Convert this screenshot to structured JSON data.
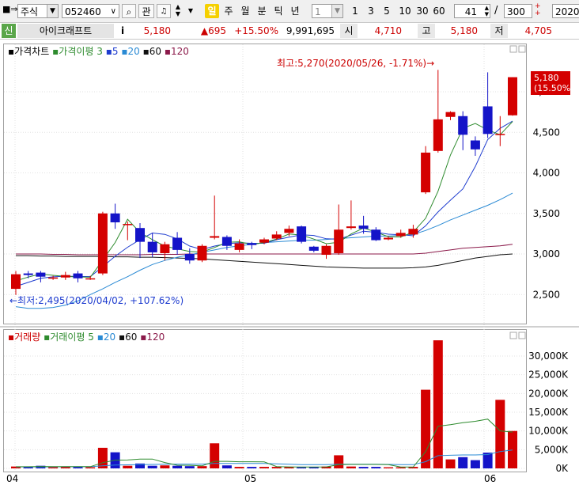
{
  "toolbar": {
    "market": "주식",
    "code": "052460",
    "gwan_label": "관",
    "periods": [
      "일",
      "주",
      "월",
      "분",
      "틱",
      "년"
    ],
    "selected_period": "일",
    "unit_value": "1",
    "intervals": [
      "1",
      "3",
      "5",
      "10",
      "30",
      "60"
    ],
    "count_value": "41",
    "count_total": "300",
    "date_value": "2020/"
  },
  "quote": {
    "tag": "신",
    "name": "아이크래프트",
    "info_icon": "i",
    "price": "5,180",
    "change": "▲695",
    "change_pct": "+15.50%",
    "volume": "9,991,695",
    "open_label": "시",
    "open": "4,710",
    "high_label": "고",
    "high": "5,180",
    "low_label": "저",
    "low": "4,705"
  },
  "price_panel": {
    "legend": [
      {
        "text": "가격차트",
        "color": "#000000"
      },
      {
        "text": "가격이평 3",
        "color": "#2e8b2e"
      },
      {
        "text": "5",
        "color": "#1e3ccf"
      },
      {
        "text": "20",
        "color": "#2a8ad4"
      },
      {
        "text": "60",
        "color": "#111111"
      },
      {
        "text": "120",
        "color": "#8b1a4a"
      }
    ],
    "y_ticks": [
      "5,000",
      "4,500",
      "4,000",
      "3,500",
      "3,000",
      "2,500"
    ],
    "annotation_high": "최고:5,270(2020/05/26, -1.71%)→",
    "annotation_low": "←최저:2,495(2020/04/02, +107.62%)",
    "last_price_label": "5,180",
    "last_pct_label": "(15.50%)"
  },
  "volume_panel": {
    "legend": [
      {
        "text": "거래량",
        "color": "#cc0000"
      },
      {
        "text": "거래이평 5",
        "color": "#2e8b2e"
      },
      {
        "text": "20",
        "color": "#2a8ad4"
      },
      {
        "text": "60",
        "color": "#111111"
      },
      {
        "text": "120",
        "color": "#8b1a4a"
      }
    ],
    "y_ticks": [
      "30,000K",
      "25,000K",
      "20,000K",
      "15,000K",
      "10,000K",
      "5,000K",
      "0K"
    ]
  },
  "x_axis": {
    "labels": [
      "04",
      "05",
      "06"
    ]
  },
  "chart_data": {
    "type": "candlestick",
    "y_ticks": [
      2500,
      3000,
      3500,
      4000,
      4500,
      5000
    ],
    "volume_ticks_k": [
      0,
      5000,
      10000,
      15000,
      20000,
      25000,
      30000
    ],
    "candles": [
      {
        "o": 2570,
        "c": 2750,
        "h": 2790,
        "l": 2495,
        "v": 500
      },
      {
        "o": 2760,
        "c": 2740,
        "h": 2790,
        "l": 2700,
        "v": 500
      },
      {
        "o": 2770,
        "c": 2720,
        "h": 2790,
        "l": 2650,
        "v": 700
      },
      {
        "o": 2700,
        "c": 2710,
        "h": 2730,
        "l": 2680,
        "v": 300
      },
      {
        "o": 2710,
        "c": 2740,
        "h": 2780,
        "l": 2680,
        "v": 400
      },
      {
        "o": 2760,
        "c": 2700,
        "h": 2790,
        "l": 2650,
        "v": 400
      },
      {
        "o": 2700,
        "c": 2700,
        "h": 2730,
        "l": 2680,
        "v": 300
      },
      {
        "o": 2760,
        "c": 3500,
        "h": 3520,
        "l": 2740,
        "v": 5500
      },
      {
        "o": 3500,
        "c": 3390,
        "h": 3620,
        "l": 3310,
        "v": 4300
      },
      {
        "o": 3360,
        "c": 3370,
        "h": 3400,
        "l": 3170,
        "v": 700
      },
      {
        "o": 3320,
        "c": 3150,
        "h": 3380,
        "l": 2950,
        "v": 1300
      },
      {
        "o": 3150,
        "c": 3020,
        "h": 3260,
        "l": 2960,
        "v": 700
      },
      {
        "o": 3010,
        "c": 3120,
        "h": 3150,
        "l": 2920,
        "v": 800
      },
      {
        "o": 3200,
        "c": 3050,
        "h": 3270,
        "l": 2990,
        "v": 700
      },
      {
        "o": 3000,
        "c": 2920,
        "h": 3070,
        "l": 2880,
        "v": 600
      },
      {
        "o": 2920,
        "c": 3100,
        "h": 3120,
        "l": 2900,
        "v": 600
      },
      {
        "o": 3200,
        "c": 3220,
        "h": 3720,
        "l": 3180,
        "v": 6700
      },
      {
        "o": 3210,
        "c": 3100,
        "h": 3230,
        "l": 3050,
        "v": 800
      },
      {
        "o": 3050,
        "c": 3130,
        "h": 3180,
        "l": 3020,
        "v": 400
      },
      {
        "o": 3130,
        "c": 3110,
        "h": 3150,
        "l": 3060,
        "v": 400
      },
      {
        "o": 3140,
        "c": 3180,
        "h": 3200,
        "l": 3120,
        "v": 400
      },
      {
        "o": 3190,
        "c": 3240,
        "h": 3280,
        "l": 3170,
        "v": 400
      },
      {
        "o": 3260,
        "c": 3310,
        "h": 3350,
        "l": 3220,
        "v": 400
      },
      {
        "o": 3340,
        "c": 3150,
        "h": 3350,
        "l": 3130,
        "v": 300
      },
      {
        "o": 3090,
        "c": 3040,
        "h": 3100,
        "l": 3020,
        "v": 400
      },
      {
        "o": 2990,
        "c": 3100,
        "h": 3120,
        "l": 2940,
        "v": 500
      },
      {
        "o": 3010,
        "c": 3300,
        "h": 3610,
        "l": 2990,
        "v": 3500
      },
      {
        "o": 3320,
        "c": 3340,
        "h": 3660,
        "l": 3300,
        "v": 500
      },
      {
        "o": 3350,
        "c": 3310,
        "h": 3470,
        "l": 3250,
        "v": 400
      },
      {
        "o": 3300,
        "c": 3170,
        "h": 3330,
        "l": 3160,
        "v": 400
      },
      {
        "o": 3180,
        "c": 3200,
        "h": 3220,
        "l": 3170,
        "v": 300
      },
      {
        "o": 3220,
        "c": 3260,
        "h": 3300,
        "l": 3200,
        "v": 300
      },
      {
        "o": 3240,
        "c": 3310,
        "h": 3360,
        "l": 3200,
        "v": 400
      },
      {
        "o": 3760,
        "c": 4250,
        "h": 4330,
        "l": 3740,
        "v": 21000
      },
      {
        "o": 4270,
        "c": 4660,
        "h": 5270,
        "l": 4250,
        "v": 34200
      },
      {
        "o": 4690,
        "c": 4750,
        "h": 4760,
        "l": 4650,
        "v": 2400
      },
      {
        "o": 4700,
        "c": 4470,
        "h": 4760,
        "l": 4280,
        "v": 3000
      },
      {
        "o": 4400,
        "c": 4290,
        "h": 4450,
        "l": 4210,
        "v": 2200
      },
      {
        "o": 4820,
        "c": 4480,
        "h": 5240,
        "l": 4430,
        "v": 4200
      },
      {
        "o": 4470,
        "c": 4480,
        "h": 4700,
        "l": 4330,
        "v": 18300
      },
      {
        "o": 4710,
        "c": 5180,
        "h": 5180,
        "l": 4705,
        "v": 9990
      }
    ],
    "ma3": [
      2668,
      2715,
      2753,
      2737,
      2723,
      2717,
      2713,
      2926,
      3141,
      3428,
      3264,
      3177,
      3097,
      3063,
      3030,
      3023,
      3080,
      3143,
      3150,
      3117,
      3140,
      3183,
      3246,
      3233,
      3183,
      3127,
      3143,
      3247,
      3320,
      3270,
      3213,
      3210,
      3270,
      3440,
      3774,
      4220,
      4550,
      4610,
      4530,
      4470,
      4633
    ],
    "ma5": [
      2600,
      2650,
      2700,
      2718,
      2726,
      2723,
      2721,
      2844,
      2972,
      3083,
      3178,
      3259,
      3242,
      3186,
      3098,
      3055,
      3098,
      3127,
      3138,
      3132,
      3132,
      3176,
      3207,
      3237,
      3228,
      3187,
      3181,
      3232,
      3281,
      3267,
      3244,
      3237,
      3224,
      3347,
      3518,
      3663,
      3803,
      4079,
      4411,
      4549,
      4639
    ],
    "ma20": [
      2350,
      2330,
      2330,
      2340,
      2370,
      2420,
      2500,
      2570,
      2650,
      2720,
      2800,
      2870,
      2920,
      2960,
      2990,
      3020,
      3050,
      3080,
      3100,
      3120,
      3140,
      3150,
      3160,
      3170,
      3170,
      3180,
      3190,
      3200,
      3210,
      3220,
      3220,
      3230,
      3240,
      3290,
      3350,
      3420,
      3480,
      3540,
      3600,
      3670,
      3750
    ],
    "ma60": [
      2980,
      2980,
      2975,
      2975,
      2970,
      2970,
      2970,
      2970,
      2965,
      2965,
      2960,
      2960,
      2955,
      2950,
      2945,
      2940,
      2930,
      2920,
      2910,
      2900,
      2890,
      2880,
      2870,
      2860,
      2850,
      2840,
      2835,
      2830,
      2825,
      2825,
      2825,
      2825,
      2830,
      2840,
      2860,
      2890,
      2920,
      2950,
      2970,
      2990,
      3000
    ],
    "ma120": [
      3000,
      3000,
      3000,
      2995,
      2995,
      2990,
      2990,
      2990,
      2990,
      2990,
      2990,
      2995,
      2995,
      2995,
      3000,
      3000,
      3000,
      3000,
      3000,
      3000,
      3000,
      3000,
      3000,
      3000,
      3000,
      3000,
      3000,
      3000,
      3000,
      3000,
      3000,
      3000,
      3000,
      3010,
      3030,
      3050,
      3070,
      3080,
      3090,
      3100,
      3120
    ],
    "vma5": [
      450,
      450,
      500,
      460,
      460,
      480,
      460,
      1530,
      2200,
      2240,
      2480,
      2500,
      1560,
      840,
      820,
      680,
      1880,
      1880,
      1780,
      1780,
      1740,
      490,
      400,
      380,
      380,
      400,
      1020,
      1060,
      1060,
      1060,
      1020,
      380,
      360,
      4480,
      11260,
      11660,
      12200,
      12560,
      13160,
      10020,
      9700
    ],
    "vma20": [
      400,
      400,
      400,
      400,
      450,
      450,
      450,
      700,
      900,
      950,
      1000,
      1050,
      1100,
      1150,
      1150,
      1150,
      1300,
      1300,
      1300,
      1300,
      1300,
      1200,
      1100,
      1000,
      1000,
      1000,
      1100,
      1100,
      1100,
      1100,
      1050,
      1000,
      1000,
      1800,
      3400,
      3500,
      3600,
      3600,
      3700,
      4500,
      4900
    ]
  }
}
